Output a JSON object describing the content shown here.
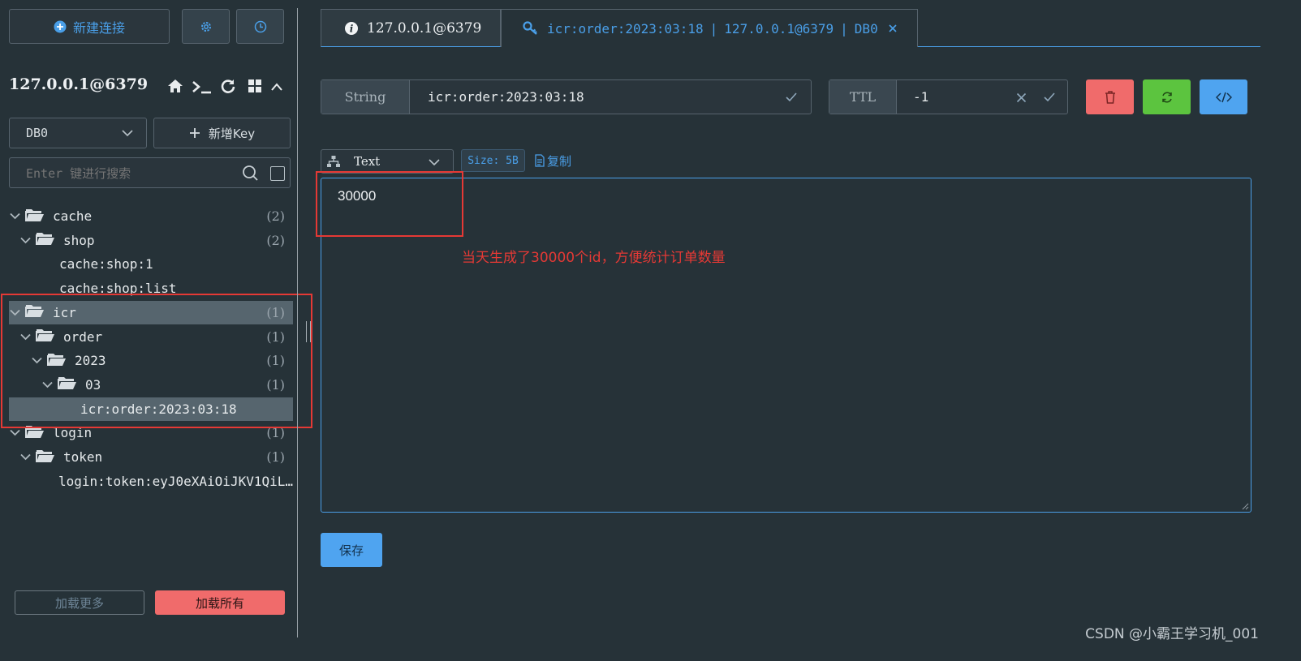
{
  "sidebar": {
    "new_connection_label": "新建连接",
    "connection_name": "127.0.0.1@6379",
    "db_select_value": "DB0",
    "new_key_label": "新增Key",
    "search_placeholder": "Enter 键进行搜索",
    "tree": [
      {
        "id": "cache",
        "label": "cache",
        "count": "(2)",
        "level": 0,
        "type": "folder"
      },
      {
        "id": "shop",
        "label": "shop",
        "count": "(2)",
        "level": 1,
        "type": "folder"
      },
      {
        "id": "cache-shop-1",
        "label": "cache:shop:1",
        "count": "",
        "level": 2,
        "type": "key"
      },
      {
        "id": "cache-shop-list",
        "label": "cache:shop:list",
        "count": "",
        "level": 2,
        "type": "key"
      },
      {
        "id": "icr",
        "label": "icr",
        "count": "(1)",
        "level": 0,
        "type": "folder",
        "selected": true
      },
      {
        "id": "order",
        "label": "order",
        "count": "(1)",
        "level": 1,
        "type": "folder"
      },
      {
        "id": "2023",
        "label": "2023",
        "count": "(1)",
        "level": 2,
        "type": "folder"
      },
      {
        "id": "03",
        "label": "03",
        "count": "(1)",
        "level": 3,
        "type": "folder"
      },
      {
        "id": "icr-key",
        "label": "icr:order:2023:03:18",
        "count": "",
        "level": 4,
        "type": "key",
        "selected": true
      },
      {
        "id": "login",
        "label": "login",
        "count": "(1)",
        "level": 0,
        "type": "folder"
      },
      {
        "id": "token",
        "label": "token",
        "count": "(1)",
        "level": 1,
        "type": "folder"
      },
      {
        "id": "login-token",
        "label": "login:token:eyJ0eXAiOiJKV1QiL…",
        "count": "",
        "level": 2,
        "type": "key"
      }
    ],
    "load_more_label": "加载更多",
    "load_all_label": "加载所有"
  },
  "tabs": {
    "info_tab_label": "127.0.0.1@6379",
    "key_tab": {
      "key": "icr:order:2023:03:18",
      "conn": "127.0.0.1@6379",
      "db": "DB0"
    }
  },
  "key_panel": {
    "type_label": "String",
    "key_value": "icr:order:2023:03:18",
    "ttl_label": "TTL",
    "ttl_value": "-1",
    "format_value": "Text",
    "size_label": "Size: 5B",
    "copy_label": "复制",
    "value": "30000",
    "save_label": "保存"
  },
  "annotation": {
    "text": "当天生成了30000个id，方便统计订单数量"
  },
  "watermark": "CSDN @小霸王学习机_001",
  "colors": {
    "bg": "#263238",
    "accent": "#4a9fe8",
    "delete": "#f06b6b",
    "refresh": "#5cc43f",
    "code": "#4fa4f0",
    "annotation_red": "#e53935"
  }
}
